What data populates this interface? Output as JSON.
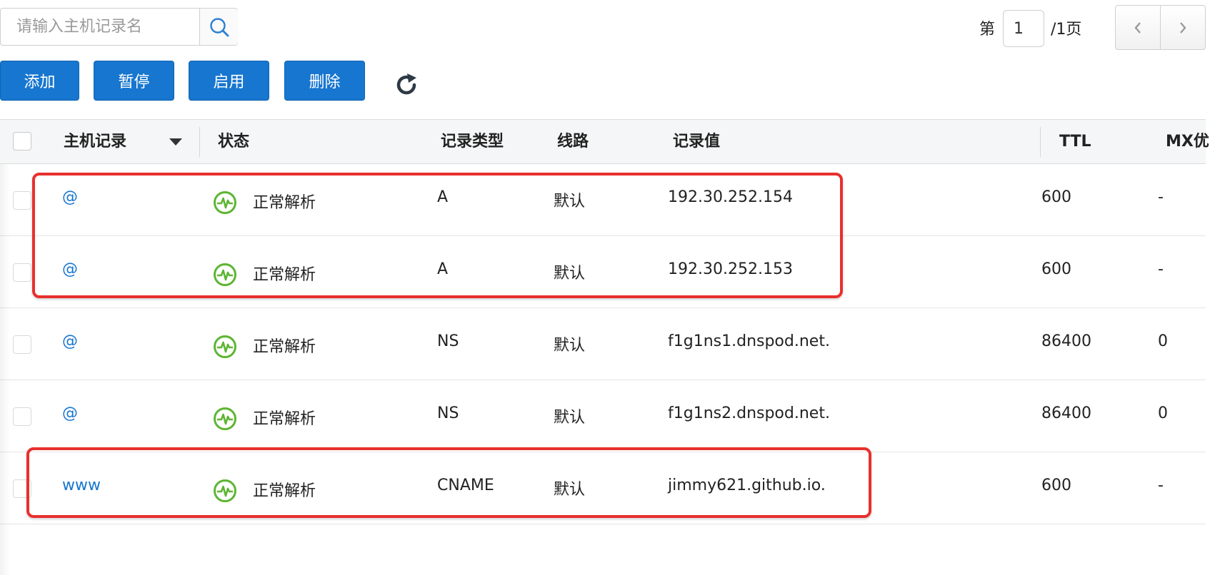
{
  "search": {
    "placeholder": "请输入主机记录名",
    "icon": "search-icon"
  },
  "pagination": {
    "prefix": "第",
    "current_page": "1",
    "suffix": "/1页",
    "prev_icon": "chevron-left-icon",
    "next_icon": "chevron-right-icon"
  },
  "toolbar": {
    "add_label": "添加",
    "pause_label": "暂停",
    "enable_label": "启用",
    "delete_label": "删除",
    "refresh_icon": "refresh-icon"
  },
  "table": {
    "columns": {
      "host": "主机记录",
      "status": "状态",
      "type": "记录类型",
      "line": "线路",
      "value": "记录值",
      "ttl": "TTL",
      "mx": "MX优"
    },
    "rows": [
      {
        "host": "@",
        "status": "正常解析",
        "type": "A",
        "line": "默认",
        "value": "192.30.252.154",
        "ttl": "600",
        "mx": "-"
      },
      {
        "host": "@",
        "status": "正常解析",
        "type": "A",
        "line": "默认",
        "value": "192.30.252.153",
        "ttl": "600",
        "mx": "-"
      },
      {
        "host": "@",
        "status": "正常解析",
        "type": "NS",
        "line": "默认",
        "value": "f1g1ns1.dnspod.net.",
        "ttl": "86400",
        "mx": "0"
      },
      {
        "host": "@",
        "status": "正常解析",
        "type": "NS",
        "line": "默认",
        "value": "f1g1ns2.dnspod.net.",
        "ttl": "86400",
        "mx": "0"
      },
      {
        "host": "www",
        "status": "正常解析",
        "type": "CNAME",
        "line": "默认",
        "value": "jimmy621.github.io.",
        "ttl": "600",
        "mx": "-"
      }
    ]
  },
  "colors": {
    "accent": "#1776cf",
    "status_ok": "#5cb531",
    "highlight": "#e8302d"
  }
}
